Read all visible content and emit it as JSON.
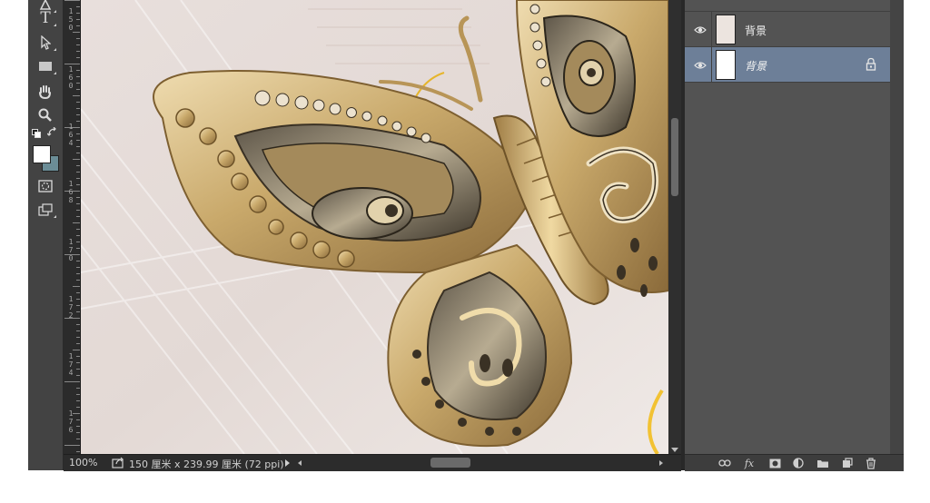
{
  "toolbar": {
    "tools": [
      "pen-tool",
      "type-tool",
      "path-selection-tool",
      "rectangle-tool",
      "hand-tool",
      "zoom-tool",
      "swap-colors",
      "quick-mask",
      "screen-mode"
    ],
    "type_glyph": "T",
    "foreground_color": "#ffffff",
    "background_color": "#6b8d97"
  },
  "ruler": {
    "labels": [
      "150",
      "160",
      "1 6 4",
      "168",
      "170",
      "172",
      "174",
      "176"
    ]
  },
  "status": {
    "zoom": "100%",
    "doc_size": "150 厘米 x 239.99 厘米 (72 ppi)"
  },
  "layers": {
    "items": [
      {
        "name": "背景",
        "visible": true,
        "selected": false,
        "locked": false,
        "italic": false,
        "thumb_color": "#ece4df"
      },
      {
        "name": "背景",
        "visible": true,
        "selected": true,
        "locked": true,
        "italic": true,
        "thumb_color": "#ffffff"
      }
    ]
  },
  "panel_footer": {
    "buttons": [
      "link-layers",
      "fx",
      "add-mask",
      "adjustment-layer",
      "new-group",
      "new-layer",
      "delete-layer"
    ],
    "fx_label": "fx"
  },
  "colors": {
    "app_bg": "#3c3c3c",
    "panel_bg": "#535353",
    "selected_layer": "#6d7f98",
    "canvas_bg": "#e8e0dc",
    "gold": "#c9a96b"
  }
}
